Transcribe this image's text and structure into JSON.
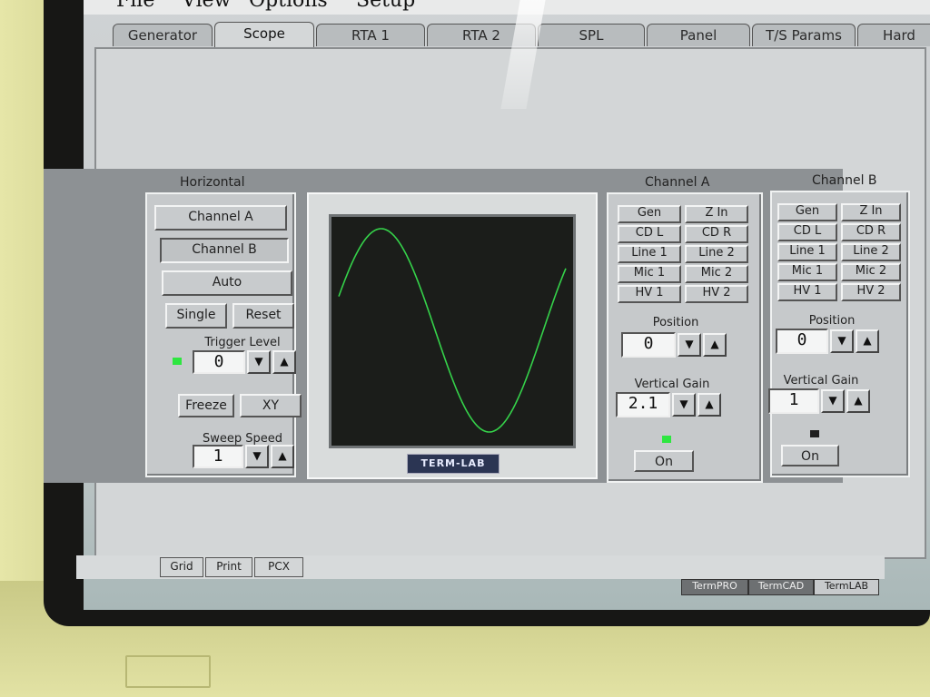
{
  "menu": [
    "File",
    "View",
    "Options",
    "Setup"
  ],
  "tabs": [
    "Generator",
    "Scope",
    "RTA 1",
    "RTA 2",
    "SPL",
    "Panel",
    "T/S Params",
    "Hard"
  ],
  "active_tab": "Scope",
  "horizontal": {
    "title": "Horizontal",
    "channel_a": "Channel A",
    "channel_b": "Channel B",
    "auto": "Auto",
    "single": "Single",
    "reset": "Reset",
    "trigger_label": "Trigger Level",
    "trigger_value": "0",
    "freeze": "Freeze",
    "xy": "XY",
    "sweep_label": "Sweep Speed",
    "sweep_value": "1"
  },
  "channel_a": {
    "title": "Channel A",
    "inputs": [
      "Gen",
      "Z In",
      "CD L",
      "CD R",
      "Line 1",
      "Line 2",
      "Mic 1",
      "Mic 2",
      "HV 1",
      "HV 2"
    ],
    "position_label": "Position",
    "position_value": "0",
    "gain_label": "Vertical Gain",
    "gain_value": "2.1",
    "on_label": "On"
  },
  "channel_b": {
    "title": "Channel B",
    "inputs": [
      "Gen",
      "Z In",
      "CD L",
      "CD R",
      "Line 1",
      "Line 2",
      "Mic 1",
      "Mic 2",
      "HV 1",
      "HV 2"
    ],
    "position_label": "Position",
    "position_value": "0",
    "gain_label": "Vertical Gain",
    "gain_value": "1",
    "on_label": "On"
  },
  "logo": "TERM-LAB",
  "bottom_buttons": [
    "Grid",
    "Print",
    "PCX"
  ],
  "status_tabs": [
    "TermPRO",
    "TermCAD",
    "TermLAB"
  ],
  "colors": {
    "trace": "#35d24a",
    "led_on": "#2ee640",
    "led_off": "#1f1f1f"
  },
  "icons": {
    "up": "▲",
    "down": "▼"
  }
}
